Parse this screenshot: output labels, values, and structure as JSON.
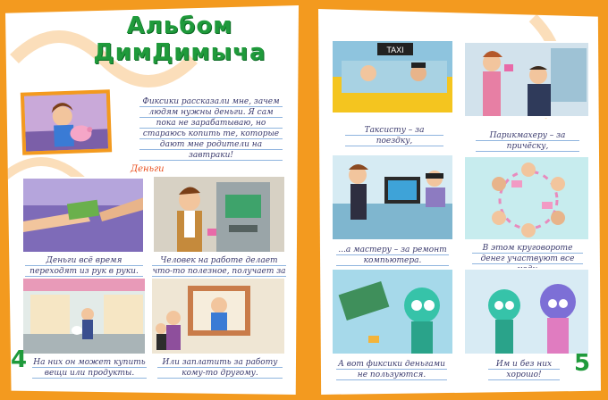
{
  "left_page": {
    "title": "Альбом ДимДимыча",
    "intro_text": "Фиксики рассказали мне, зачем людям нужны деньги. Я сам пока не зарабатываю, но стараюсь копить те, которые дают мне родители на завтраки!",
    "section_label": "Деньги",
    "captions": [
      "Деньги всё время переходят из рук в руки.",
      "Человек на работе делает что-то полезное, получает за это деньги.",
      "На них он может купить вещи или продукты.",
      "Или заплатить за работу кому-то другому."
    ],
    "page_number": "4"
  },
  "right_page": {
    "captions": [
      "Таксисту – за поездку,",
      "Парикмахеру – за причёску,",
      "...а мастеру – за ремонт компьютера.",
      "В этом круговороте денег участвуют все люди.",
      "А вот фиксики деньгами не пользуются.",
      "Им и без них хорошо!"
    ],
    "taxi_sign": "TAXI",
    "page_number": "5"
  },
  "colors": {
    "background": "#f39a1f",
    "title_green": "#1f9a3b",
    "section_red": "#e84d1c"
  }
}
